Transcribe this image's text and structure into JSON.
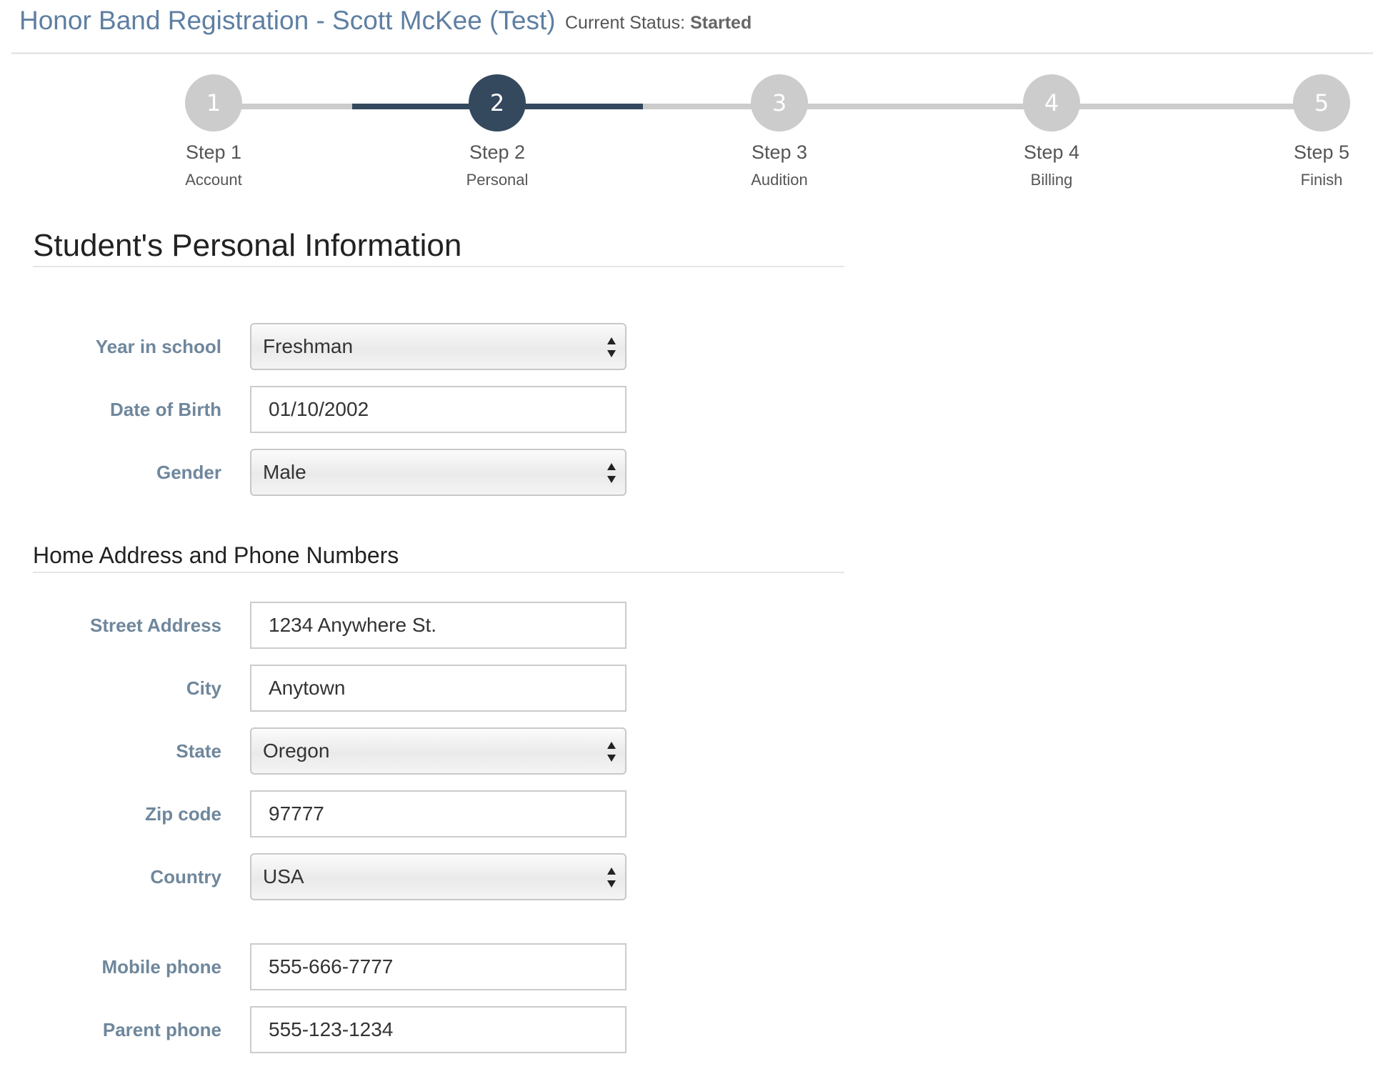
{
  "header": {
    "title": "Honor Band Registration - Scott McKee (Test)",
    "status_label": "Current Status:",
    "status_value": "Started"
  },
  "wizard": {
    "steps": [
      {
        "number": "1",
        "title": "Step 1",
        "subtitle": "Account",
        "state": "inactive"
      },
      {
        "number": "2",
        "title": "Step 2",
        "subtitle": "Personal",
        "state": "active"
      },
      {
        "number": "3",
        "title": "Step 3",
        "subtitle": "Audition",
        "state": "inactive"
      },
      {
        "number": "4",
        "title": "Step 4",
        "subtitle": "Billing",
        "state": "inactive"
      },
      {
        "number": "5",
        "title": "Step 5",
        "subtitle": "Finish",
        "state": "inactive"
      }
    ],
    "colors": {
      "active": "#34495e",
      "inactive": "#cccccc"
    }
  },
  "personal": {
    "heading": "Student's Personal Information",
    "year_in_school": {
      "label": "Year in school",
      "value": "Freshman"
    },
    "date_of_birth": {
      "label": "Date of Birth",
      "value": "01/10/2002"
    },
    "gender": {
      "label": "Gender",
      "value": "Male"
    }
  },
  "address": {
    "heading": "Home Address and Phone Numbers",
    "street": {
      "label": "Street Address",
      "value": "1234 Anywhere St."
    },
    "city": {
      "label": "City",
      "value": "Anytown"
    },
    "state": {
      "label": "State",
      "value": "Oregon"
    },
    "zip": {
      "label": "Zip code",
      "value": "97777"
    },
    "country": {
      "label": "Country",
      "value": "USA"
    },
    "mobile_phone": {
      "label": "Mobile phone",
      "value": "555-666-7777"
    },
    "parent_phone": {
      "label": "Parent phone",
      "value": "555-123-1234"
    }
  },
  "colors": {
    "title_blue": "#5e7fa2",
    "label_gray_blue": "#6f879c",
    "wizard_active": "#34495e"
  }
}
